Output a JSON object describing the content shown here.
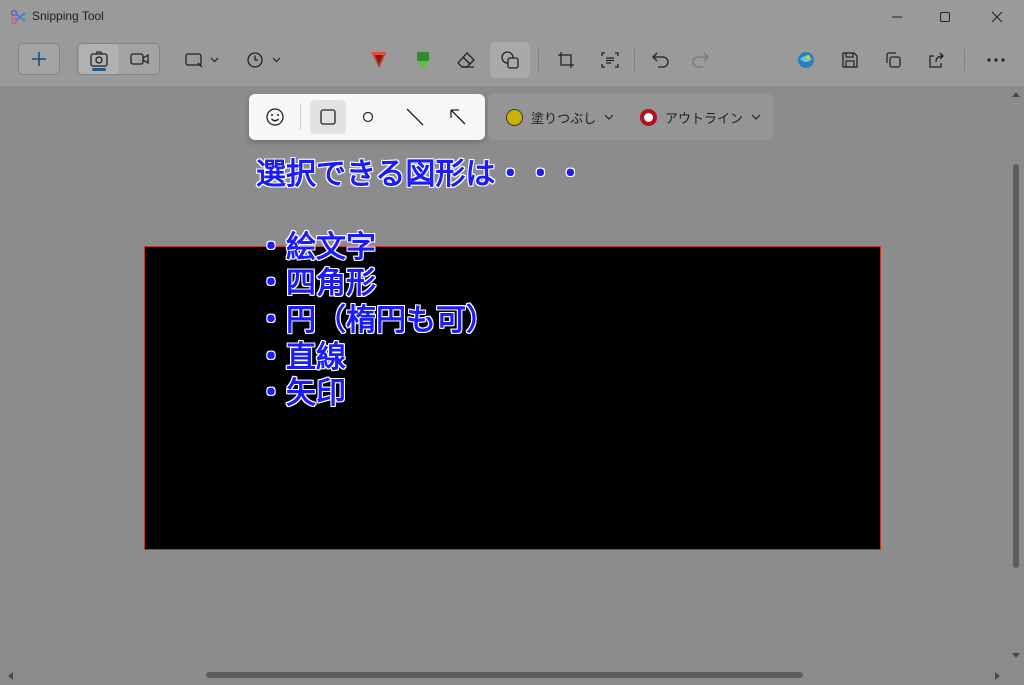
{
  "window": {
    "title": "Snipping Tool"
  },
  "options": {
    "fill_label": "塗りつぶし",
    "outline_label": "アウトライン",
    "fill_color": "#c8b400",
    "outline_color": "#b01020"
  },
  "annotation": {
    "heading": "選択できる図形は・・・",
    "items": [
      "・絵文字",
      "・四角形",
      "・円（楕円も可）",
      "・直線",
      "・矢印"
    ]
  },
  "colors": {
    "accent": "#1f5c8c",
    "annotation_text": "#1b1bff",
    "pen_red": "#c0392b",
    "highlighter_green": "#2e8b2e"
  }
}
